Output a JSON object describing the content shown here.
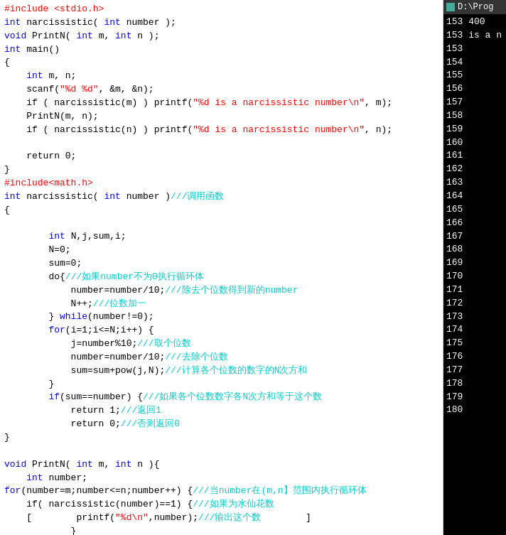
{
  "code": {
    "lines": [
      {
        "id": 1,
        "tokens": [
          {
            "t": "#include <stdio.h>",
            "c": "inc"
          }
        ]
      },
      {
        "id": 2,
        "tokens": [
          {
            "t": "int",
            "c": "kw"
          },
          {
            "t": " narcissistic( ",
            "c": "plain"
          },
          {
            "t": "int",
            "c": "kw"
          },
          {
            "t": " number );",
            "c": "plain"
          }
        ]
      },
      {
        "id": 3,
        "tokens": [
          {
            "t": "void",
            "c": "kw"
          },
          {
            "t": " PrintN( ",
            "c": "plain"
          },
          {
            "t": "int",
            "c": "kw"
          },
          {
            "t": " m, ",
            "c": "plain"
          },
          {
            "t": "int",
            "c": "kw"
          },
          {
            "t": " n );",
            "c": "plain"
          }
        ]
      },
      {
        "id": 4,
        "tokens": [
          {
            "t": "int",
            "c": "kw"
          },
          {
            "t": " main()",
            "c": "plain"
          }
        ]
      },
      {
        "id": 5,
        "tokens": [
          {
            "t": "{",
            "c": "plain"
          }
        ]
      },
      {
        "id": 6,
        "tokens": [
          {
            "t": "    int",
            "c": "kw"
          },
          {
            "t": " m, n;",
            "c": "plain"
          }
        ]
      },
      {
        "id": 7,
        "tokens": [
          {
            "t": "    scanf(",
            "c": "plain"
          },
          {
            "t": "\"%d %d\"",
            "c": "str"
          },
          {
            "t": ", &m, &n);",
            "c": "plain"
          }
        ]
      },
      {
        "id": 8,
        "tokens": [
          {
            "t": "    if ( narcissistic(m) ) printf(",
            "c": "plain"
          },
          {
            "t": "\"%d is a narcissistic number\\n\"",
            "c": "str"
          },
          {
            "t": ", m);",
            "c": "plain"
          }
        ]
      },
      {
        "id": 9,
        "tokens": [
          {
            "t": "    PrintN(m, n);",
            "c": "plain"
          }
        ]
      },
      {
        "id": 10,
        "tokens": [
          {
            "t": "    if ( narcissistic(n) ) printf(",
            "c": "plain"
          },
          {
            "t": "\"%d is a narcissistic number\\n\"",
            "c": "str"
          },
          {
            "t": ", n);",
            "c": "plain"
          }
        ]
      },
      {
        "id": 11,
        "tokens": []
      },
      {
        "id": 12,
        "tokens": [
          {
            "t": "    return 0;",
            "c": "plain"
          }
        ]
      },
      {
        "id": 13,
        "tokens": [
          {
            "t": "}",
            "c": "plain"
          }
        ]
      },
      {
        "id": 14,
        "tokens": [
          {
            "t": "#include<math.h>",
            "c": "inc"
          }
        ]
      },
      {
        "id": 15,
        "tokens": [
          {
            "t": "int",
            "c": "kw"
          },
          {
            "t": " narcissistic( ",
            "c": "plain"
          },
          {
            "t": "int",
            "c": "kw"
          },
          {
            "t": " number )",
            "c": "plain"
          },
          {
            "t": "///调用函数",
            "c": "cmt"
          }
        ]
      },
      {
        "id": 16,
        "tokens": [
          {
            "t": "{",
            "c": "plain"
          }
        ]
      },
      {
        "id": 17,
        "tokens": []
      },
      {
        "id": 18,
        "tokens": [
          {
            "t": "        int",
            "c": "kw"
          },
          {
            "t": " N,j,sum,i;",
            "c": "plain"
          }
        ]
      },
      {
        "id": 19,
        "tokens": [
          {
            "t": "        N=0;",
            "c": "plain"
          }
        ]
      },
      {
        "id": 20,
        "tokens": [
          {
            "t": "        sum=0;",
            "c": "plain"
          }
        ]
      },
      {
        "id": 21,
        "tokens": [
          {
            "t": "        do{",
            "c": "plain"
          },
          {
            "t": "///如果number不为0执行循环体",
            "c": "cmt"
          }
        ]
      },
      {
        "id": 22,
        "tokens": [
          {
            "t": "            number=number/10;",
            "c": "plain"
          },
          {
            "t": "///除去个位数得到新的number",
            "c": "cmt"
          }
        ]
      },
      {
        "id": 23,
        "tokens": [
          {
            "t": "            N++;",
            "c": "plain"
          },
          {
            "t": "///位数加一",
            "c": "cmt"
          }
        ]
      },
      {
        "id": 24,
        "tokens": [
          {
            "t": "        } ",
            "c": "plain"
          },
          {
            "t": "while",
            "c": "kw"
          },
          {
            "t": "(number!=0);",
            "c": "plain"
          }
        ]
      },
      {
        "id": 25,
        "tokens": [
          {
            "t": "        for",
            "c": "kw"
          },
          {
            "t": "(i=1;i<=N;i++) {",
            "c": "plain"
          }
        ]
      },
      {
        "id": 26,
        "tokens": [
          {
            "t": "            j=number%10;",
            "c": "plain"
          },
          {
            "t": "///取个位数",
            "c": "cmt"
          }
        ]
      },
      {
        "id": 27,
        "tokens": [
          {
            "t": "            number=number/10;",
            "c": "plain"
          },
          {
            "t": "///去除个位数",
            "c": "cmt"
          }
        ]
      },
      {
        "id": 28,
        "tokens": [
          {
            "t": "            sum=sum+pow(j,N);",
            "c": "plain"
          },
          {
            "t": "///计算各个位数的数字的N次方和",
            "c": "cmt"
          }
        ]
      },
      {
        "id": 29,
        "tokens": [
          {
            "t": "        }",
            "c": "plain"
          }
        ]
      },
      {
        "id": 30,
        "tokens": [
          {
            "t": "        if",
            "c": "kw"
          },
          {
            "t": "(sum==number) {",
            "c": "plain"
          },
          {
            "t": "///如果各个位数数字各N次方和等于这个数",
            "c": "cmt"
          }
        ]
      },
      {
        "id": 31,
        "tokens": [
          {
            "t": "            return 1;",
            "c": "plain"
          },
          {
            "t": "///返回1",
            "c": "cmt"
          }
        ]
      },
      {
        "id": 32,
        "tokens": [
          {
            "t": "            return 0;",
            "c": "plain"
          },
          {
            "t": "///否则返回0",
            "c": "cmt"
          }
        ]
      },
      {
        "id": 33,
        "tokens": [
          {
            "t": "}",
            "c": "plain"
          }
        ]
      },
      {
        "id": 34,
        "tokens": []
      },
      {
        "id": 35,
        "tokens": [
          {
            "t": "void",
            "c": "kw"
          },
          {
            "t": " PrintN( ",
            "c": "plain"
          },
          {
            "t": "int",
            "c": "kw"
          },
          {
            "t": " m, ",
            "c": "plain"
          },
          {
            "t": "int",
            "c": "kw"
          },
          {
            "t": " n ){",
            "c": "plain"
          }
        ]
      },
      {
        "id": 36,
        "tokens": [
          {
            "t": "    int",
            "c": "kw"
          },
          {
            "t": " number;",
            "c": "plain"
          }
        ]
      },
      {
        "id": 37,
        "tokens": [
          {
            "t": "for",
            "c": "kw"
          },
          {
            "t": "(number=m;number<=n;number++) {",
            "c": "plain"
          },
          {
            "t": "///当number在(m,n】范围内执行循环体",
            "c": "cmt"
          }
        ]
      },
      {
        "id": 38,
        "tokens": [
          {
            "t": "    if( narcissistic(number)==1) {",
            "c": "plain"
          },
          {
            "t": "///如果为水仙花数",
            "c": "cmt"
          }
        ]
      },
      {
        "id": 39,
        "tokens": [
          {
            "t": "    [",
            "c": "plain"
          },
          {
            "t": "        printf(",
            "c": "plain"
          },
          {
            "t": "\"%d\\n\"",
            "c": "str"
          },
          {
            "t": ",number);",
            "c": "plain"
          },
          {
            "t": "///输出这个数",
            "c": "cmt"
          },
          {
            "t": "        ]",
            "c": "plain"
          }
        ]
      },
      {
        "id": 40,
        "tokens": [
          {
            "t": "            }",
            "c": "plain"
          }
        ]
      },
      {
        "id": 41,
        "tokens": []
      },
      {
        "id": 42,
        "tokens": [
          {
            "t": "        }",
            "c": "plain"
          }
        ]
      },
      {
        "id": 43,
        "tokens": [
          {
            "t": "    }",
            "c": "plain"
          }
        ]
      }
    ]
  },
  "output": {
    "title": "D:\\Prog",
    "lines": [
      {
        "text": "153 400",
        "special": true
      },
      {
        "text": "153 is a n",
        "special": true
      },
      {
        "text": "153",
        "special": false
      },
      {
        "text": "154",
        "special": false
      },
      {
        "text": "155",
        "special": false
      },
      {
        "text": "156",
        "special": false
      },
      {
        "text": "157",
        "special": false
      },
      {
        "text": "158",
        "special": false
      },
      {
        "text": "159",
        "special": false
      },
      {
        "text": "160",
        "special": false
      },
      {
        "text": "161",
        "special": false
      },
      {
        "text": "162",
        "special": false
      },
      {
        "text": "163",
        "special": false
      },
      {
        "text": "164",
        "special": false
      },
      {
        "text": "165",
        "special": false
      },
      {
        "text": "166",
        "special": false
      },
      {
        "text": "167",
        "special": false
      },
      {
        "text": "168",
        "special": false
      },
      {
        "text": "169",
        "special": false
      },
      {
        "text": "170",
        "special": false
      },
      {
        "text": "171",
        "special": false
      },
      {
        "text": "172",
        "special": false
      },
      {
        "text": "173",
        "special": false
      },
      {
        "text": "174",
        "special": false
      },
      {
        "text": "175",
        "special": false
      },
      {
        "text": "176",
        "special": false
      },
      {
        "text": "177",
        "special": false
      },
      {
        "text": "178",
        "special": false
      },
      {
        "text": "179",
        "special": false
      },
      {
        "text": "180",
        "special": false
      }
    ]
  }
}
